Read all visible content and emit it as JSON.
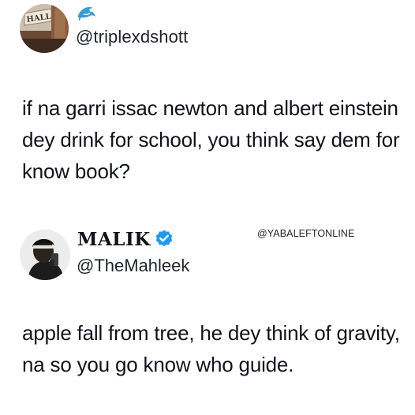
{
  "tweet1": {
    "avatar_icon": "hallway-sign-photo-avatar",
    "avatar_sign_text": "HALL",
    "badge_icon": "dolphin-icon",
    "handle": "@triplexdshott",
    "text": "if na garri issac newton and albert einstein dey drink for school, you think say dem for know book?"
  },
  "watermark": "@YABALEFTONLINE",
  "tweet2": {
    "avatar_icon": "man-selfie-avatar",
    "name": "MALIK",
    "verified_icon": "verified-badge-icon",
    "verified_color": "#1d9bf0",
    "handle": "@TheMahleek",
    "text": "apple fall from tree, he dey think of gravity, na so you go know who guide."
  }
}
